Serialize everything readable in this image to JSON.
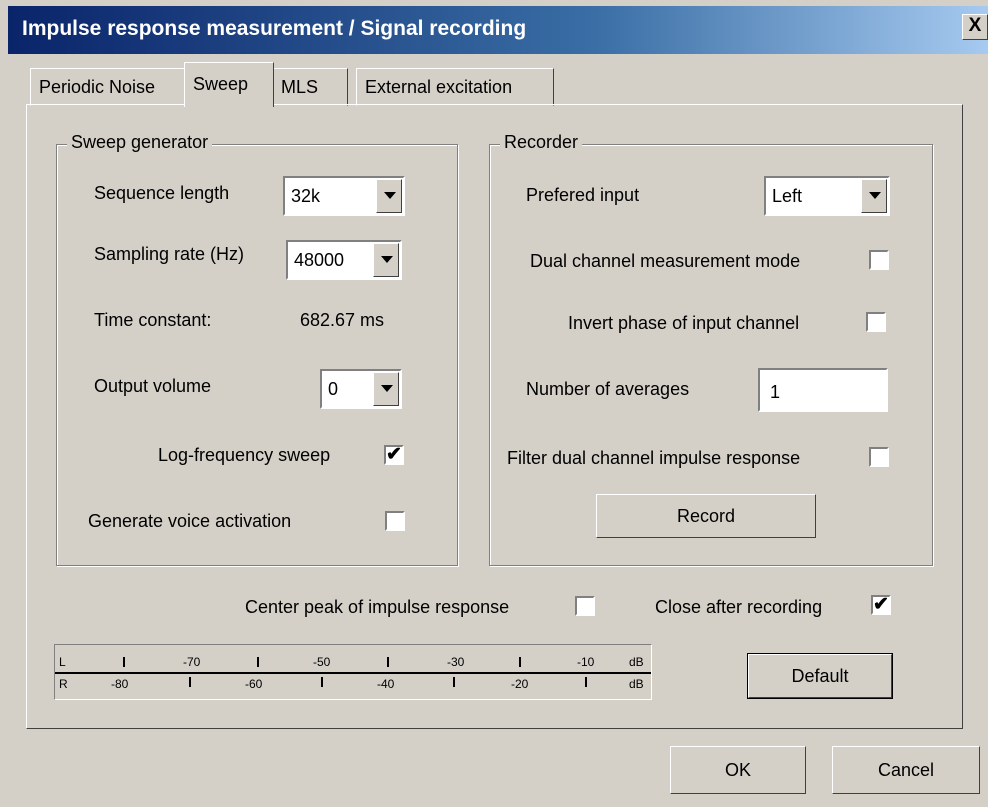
{
  "window": {
    "title": "Impulse response measurement / Signal recording",
    "close_label": "X"
  },
  "tabs": [
    {
      "label": "Periodic Noise"
    },
    {
      "label": "Sweep"
    },
    {
      "label": "MLS"
    },
    {
      "label": "External excitation"
    }
  ],
  "sweep_generator": {
    "title": "Sweep generator",
    "sequence_length_label": "Sequence length",
    "sequence_length_value": "32k",
    "sampling_rate_label": "Sampling rate (Hz)",
    "sampling_rate_value": "48000",
    "time_constant_label": "Time constant:",
    "time_constant_value": "682.67 ms",
    "output_volume_label": "Output volume",
    "output_volume_value": "0",
    "log_sweep_label": "Log-frequency sweep",
    "log_sweep_checked": "✔",
    "voice_activation_label": "Generate voice activation",
    "voice_activation_checked": ""
  },
  "recorder": {
    "title": "Recorder",
    "prefered_input_label": "Prefered input",
    "prefered_input_value": "Left",
    "dual_channel_label": "Dual channel measurement mode",
    "dual_channel_checked": "",
    "invert_phase_label": "Invert phase of input channel",
    "invert_phase_checked": "",
    "averages_label": "Number of averages",
    "averages_value": "1",
    "filter_dual_label": "Filter dual channel impulse response",
    "filter_dual_checked": "",
    "record_label": "Record"
  },
  "options": {
    "center_peak_label": "Center peak of impulse response",
    "center_peak_checked": "",
    "close_after_label": "Close after recording",
    "close_after_checked": "✔"
  },
  "meter": {
    "left_channel": "L",
    "right_channel": "R",
    "top_labels": [
      "-70",
      "-50",
      "-30",
      "-10",
      "dB"
    ],
    "bottom_labels": [
      "-80",
      "-60",
      "-40",
      "-20",
      "dB"
    ]
  },
  "buttons": {
    "default_label": "Default",
    "ok_label": "OK",
    "cancel_label": "Cancel"
  }
}
